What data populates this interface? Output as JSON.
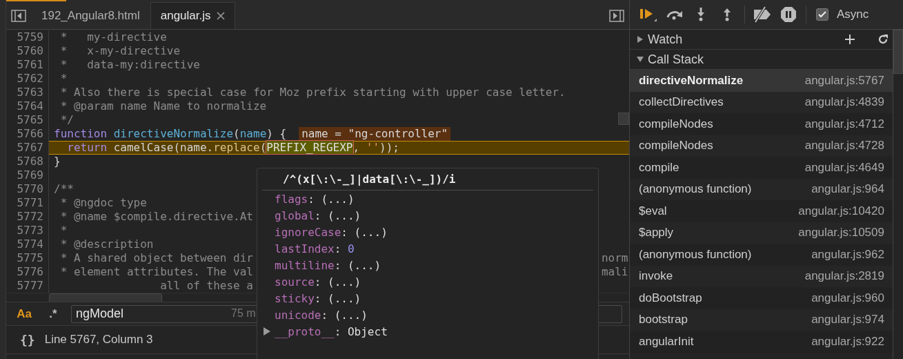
{
  "editor": {
    "tabs": [
      {
        "label": "192_Angular8.html",
        "selected": false,
        "closable": false
      },
      {
        "label": "angular.js",
        "selected": true,
        "closable": true
      }
    ],
    "lines": [
      {
        "num": "5759",
        "current": false,
        "tokens": [
          {
            "kind": "comment",
            "text": " *   my-directive"
          }
        ]
      },
      {
        "num": "5760",
        "current": false,
        "tokens": [
          {
            "kind": "comment",
            "text": " *   x-my-directive"
          }
        ]
      },
      {
        "num": "5761",
        "current": false,
        "tokens": [
          {
            "kind": "comment",
            "text": " *   data-my:directive"
          }
        ]
      },
      {
        "num": "5762",
        "current": false,
        "tokens": [
          {
            "kind": "comment",
            "text": " *"
          }
        ]
      },
      {
        "num": "5763",
        "current": false,
        "tokens": [
          {
            "kind": "comment",
            "text": " * Also there is special case for Moz prefix starting with upper case letter."
          }
        ]
      },
      {
        "num": "5764",
        "current": false,
        "tokens": [
          {
            "kind": "comment",
            "text": " * @param name Name to normalize"
          }
        ]
      },
      {
        "num": "5765",
        "current": false,
        "tokens": [
          {
            "kind": "comment",
            "text": " */"
          }
        ]
      },
      {
        "num": "5766",
        "current": false,
        "inline_value": "name = \"ng-controller\"",
        "tokens": [
          {
            "kind": "keyword",
            "text": "function"
          },
          {
            "kind": "def",
            "text": " directiveNormalize"
          },
          {
            "kind": "plain",
            "text": "("
          },
          {
            "kind": "param",
            "text": "name"
          },
          {
            "kind": "plain",
            "text": ") {"
          }
        ]
      },
      {
        "num": "5767",
        "current": true,
        "tokens": [
          {
            "kind": "keyword",
            "text": "  return"
          },
          {
            "kind": "plain",
            "text": " camelCase(name."
          },
          {
            "kind": "method",
            "text": "replace"
          },
          {
            "kind": "plain",
            "text": "("
          },
          {
            "kind": "hovered",
            "text": "PREFIX_REGEXP"
          },
          {
            "kind": "plain",
            "text": ", "
          },
          {
            "kind": "string",
            "text": "''"
          },
          {
            "kind": "plain",
            "text": "));"
          }
        ]
      },
      {
        "num": "5768",
        "current": false,
        "tokens": [
          {
            "kind": "plain",
            "text": "}"
          }
        ]
      },
      {
        "num": "5769",
        "current": false
      },
      {
        "num": "5770",
        "current": false,
        "tokens": [
          {
            "kind": "comment",
            "text": "/**"
          }
        ]
      },
      {
        "num": "5771",
        "current": false,
        "tokens": [
          {
            "kind": "comment",
            "text": " * @ngdoc type"
          }
        ]
      },
      {
        "num": "5772",
        "current": false,
        "tokens": [
          {
            "kind": "comment",
            "text": " * @name $compile.directive.At"
          }
        ]
      },
      {
        "num": "5773",
        "current": false,
        "tokens": [
          {
            "kind": "comment",
            "text": " *"
          }
        ]
      },
      {
        "num": "5774",
        "current": false,
        "tokens": [
          {
            "kind": "comment",
            "text": " * @description"
          }
        ]
      },
      {
        "num": "5775",
        "current": false,
        "tail": "norm",
        "tokens": [
          {
            "kind": "comment",
            "text": " * A shared object between dir"
          }
        ]
      },
      {
        "num": "5776",
        "current": false,
        "tail": "mali",
        "tokens": [
          {
            "kind": "comment",
            "text": " * element attributes. The val"
          }
        ]
      },
      {
        "num": "5777",
        "current": false,
        "tokens": [
          {
            "kind": "comment",
            "text": "                all of these a"
          }
        ]
      }
    ],
    "search": {
      "match_case": true,
      "match_case_label": "Aa",
      "regex": false,
      "regex_label": ".*",
      "value": "ngModel",
      "count": "75 m"
    },
    "format_label": "{}",
    "status": "Line 5767, Column 3"
  },
  "popover": {
    "title": "/^(x[\\:\\-_]|data[\\:\\-_])/i",
    "separator": ": ",
    "properties": [
      {
        "key": "flags",
        "value": "(...)",
        "kind": "lazy",
        "expandable": false
      },
      {
        "key": "global",
        "value": "(...)",
        "kind": "lazy",
        "expandable": false
      },
      {
        "key": "ignoreCase",
        "value": "(...)",
        "kind": "lazy",
        "expandable": false
      },
      {
        "key": "lastIndex",
        "value": "0",
        "kind": "number",
        "expandable": false
      },
      {
        "key": "multiline",
        "value": "(...)",
        "kind": "lazy",
        "expandable": false
      },
      {
        "key": "source",
        "value": "(...)",
        "kind": "lazy",
        "expandable": false
      },
      {
        "key": "sticky",
        "value": "(...)",
        "kind": "lazy",
        "expandable": false
      },
      {
        "key": "unicode",
        "value": "(...)",
        "kind": "lazy",
        "expandable": false
      },
      {
        "key": "__proto__",
        "value": "Object",
        "kind": "object",
        "expandable": true
      }
    ]
  },
  "debugger": {
    "async": {
      "label": "Async",
      "checked": true
    },
    "watch": {
      "label": "Watch",
      "expanded": false
    },
    "call_stack": {
      "label": "Call Stack",
      "expanded": true,
      "frames": [
        {
          "name": "directiveNormalize",
          "location": "angular.js:5767",
          "selected": true
        },
        {
          "name": "collectDirectives",
          "location": "angular.js:4839",
          "selected": false
        },
        {
          "name": "compileNodes",
          "location": "angular.js:4712",
          "selected": false
        },
        {
          "name": "compileNodes",
          "location": "angular.js:4728",
          "selected": false
        },
        {
          "name": "compile",
          "location": "angular.js:4649",
          "selected": false
        },
        {
          "name": "(anonymous function)",
          "location": "angular.js:964",
          "selected": false
        },
        {
          "name": "$eval",
          "location": "angular.js:10420",
          "selected": false
        },
        {
          "name": "$apply",
          "location": "angular.js:10509",
          "selected": false
        },
        {
          "name": "(anonymous function)",
          "location": "angular.js:962",
          "selected": false
        },
        {
          "name": "invoke",
          "location": "angular.js:2819",
          "selected": false
        },
        {
          "name": "doBootstrap",
          "location": "angular.js:960",
          "selected": false
        },
        {
          "name": "bootstrap",
          "location": "angular.js:974",
          "selected": false
        },
        {
          "name": "angularInit",
          "location": "angular.js:922",
          "selected": false
        }
      ]
    }
  }
}
